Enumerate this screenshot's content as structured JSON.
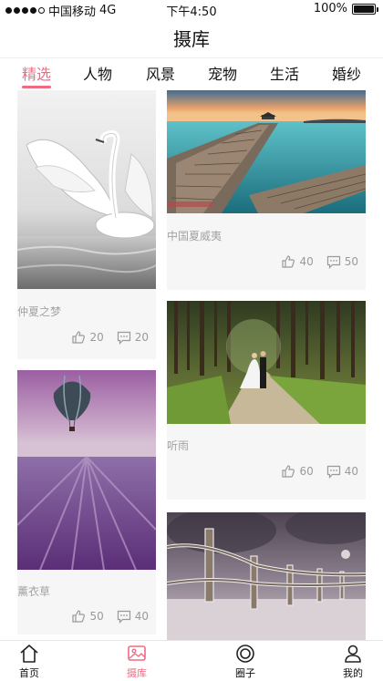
{
  "status_bar": {
    "carrier": "中国移动",
    "network": "4G",
    "time": "下午4:50",
    "battery": "100%"
  },
  "header": {
    "title": "摄库"
  },
  "categories": {
    "active_index": 0,
    "items": [
      "精选",
      "人物",
      "风景",
      "宠物",
      "生活",
      "婚纱"
    ]
  },
  "feed": {
    "cards": [
      {
        "title": "仲夏之梦",
        "likes": "20",
        "comments": "20",
        "image": "swan"
      },
      {
        "title": "中国夏威夷",
        "likes": "40",
        "comments": "50",
        "image": "pier"
      },
      {
        "title": "听雨",
        "likes": "60",
        "comments": "40",
        "image": "forest-couple"
      },
      {
        "title": "薰衣草",
        "likes": "50",
        "comments": "40",
        "image": "lavender-balloon"
      },
      {
        "title": "",
        "likes": "",
        "comments": "",
        "image": "frosty-fence"
      }
    ]
  },
  "tab_bar": {
    "items": [
      {
        "label": "首页",
        "icon": "home-icon"
      },
      {
        "label": "摄库",
        "icon": "gallery-icon"
      },
      {
        "label": "圈子",
        "icon": "circle-icon"
      },
      {
        "label": "我的",
        "icon": "user-icon"
      }
    ],
    "active_index": 1
  },
  "colors": {
    "accent": "#f06a83",
    "card_bg": "#f6f6f6",
    "muted_text": "#a3a3a3"
  }
}
